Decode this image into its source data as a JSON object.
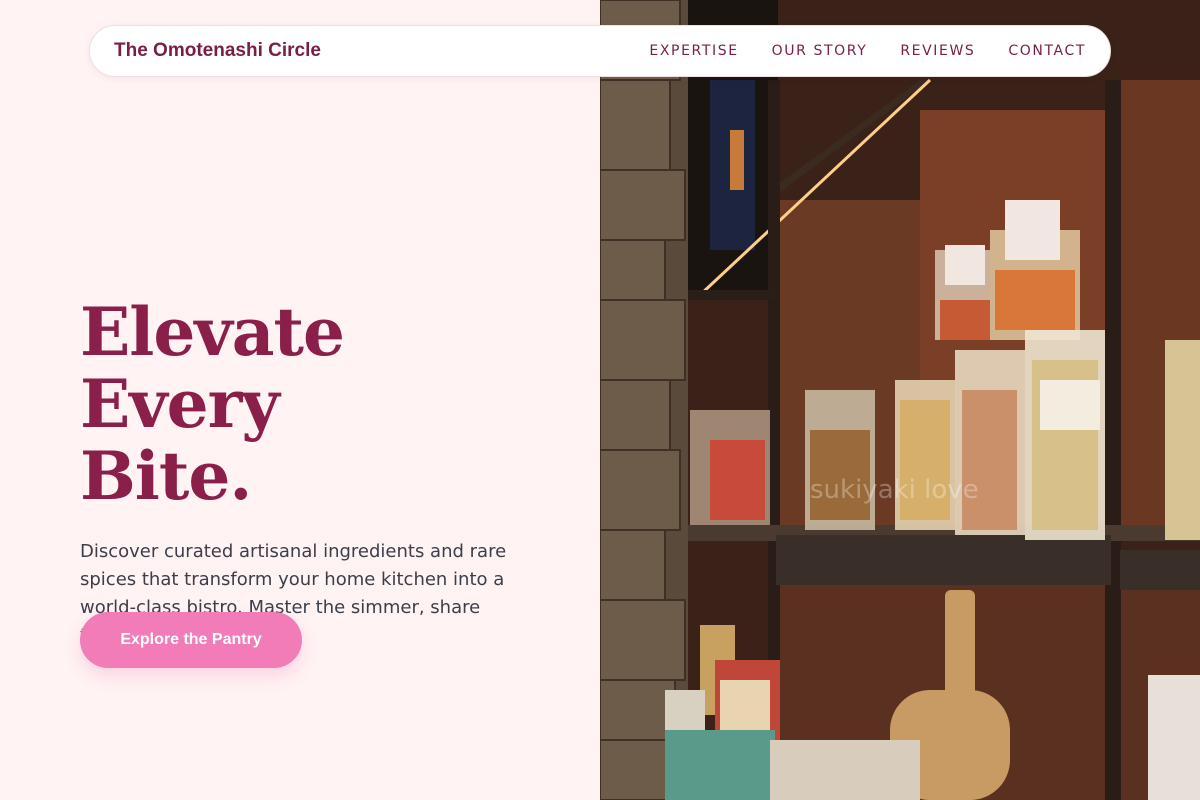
{
  "nav": {
    "brand": "The Omotenashi Circle",
    "links": [
      "EXPERTISE",
      "OUR STORY",
      "REVIEWS",
      "CONTACT"
    ]
  },
  "hero": {
    "headline_line1": "Elevate Every",
    "headline_line2": "Bite.",
    "description": "Discover curated artisanal ingredients and rare spices that transform your home kitchen into a world-class bistro. Master the simmer, share the flavor.",
    "cta_label": "Explore the Pantry",
    "image_watermark": "sukiyaki love"
  },
  "colors": {
    "background": "#fff3f3",
    "brand": "#7a1e46",
    "headline": "#8a1f4a",
    "cta": "#f17cb8",
    "body_text": "#3c3e4a"
  }
}
